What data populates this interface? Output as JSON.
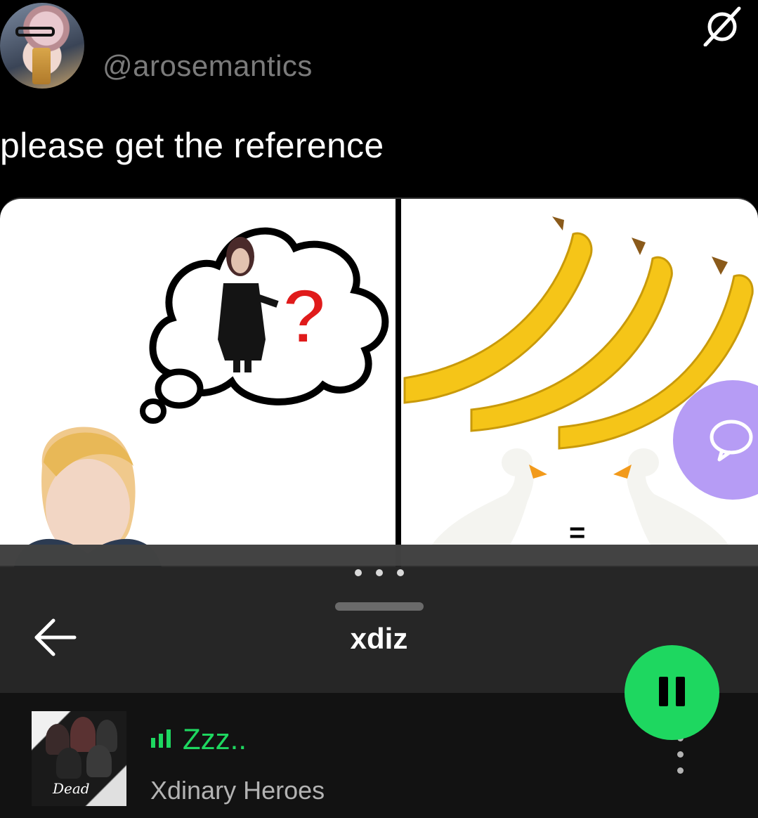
{
  "tweet": {
    "handle": "@arosemantics",
    "text": "please get the reference"
  },
  "meme": {
    "equals_sign": "="
  },
  "player": {
    "title": "xdiz",
    "track": {
      "title": "Zzz..",
      "artist": "Xdinary Heroes"
    },
    "accent_color": "#1ed760",
    "state": "playing"
  },
  "icons": [
    "no-entry-icon",
    "comment-icon",
    "back-arrow-icon",
    "now-playing-bars-icon",
    "more-vertical-icon",
    "pause-icon"
  ],
  "colors": {
    "background": "#000000",
    "sheet": "#282828",
    "track_row": "#121212",
    "comment_bubble": "#b69cf5"
  }
}
